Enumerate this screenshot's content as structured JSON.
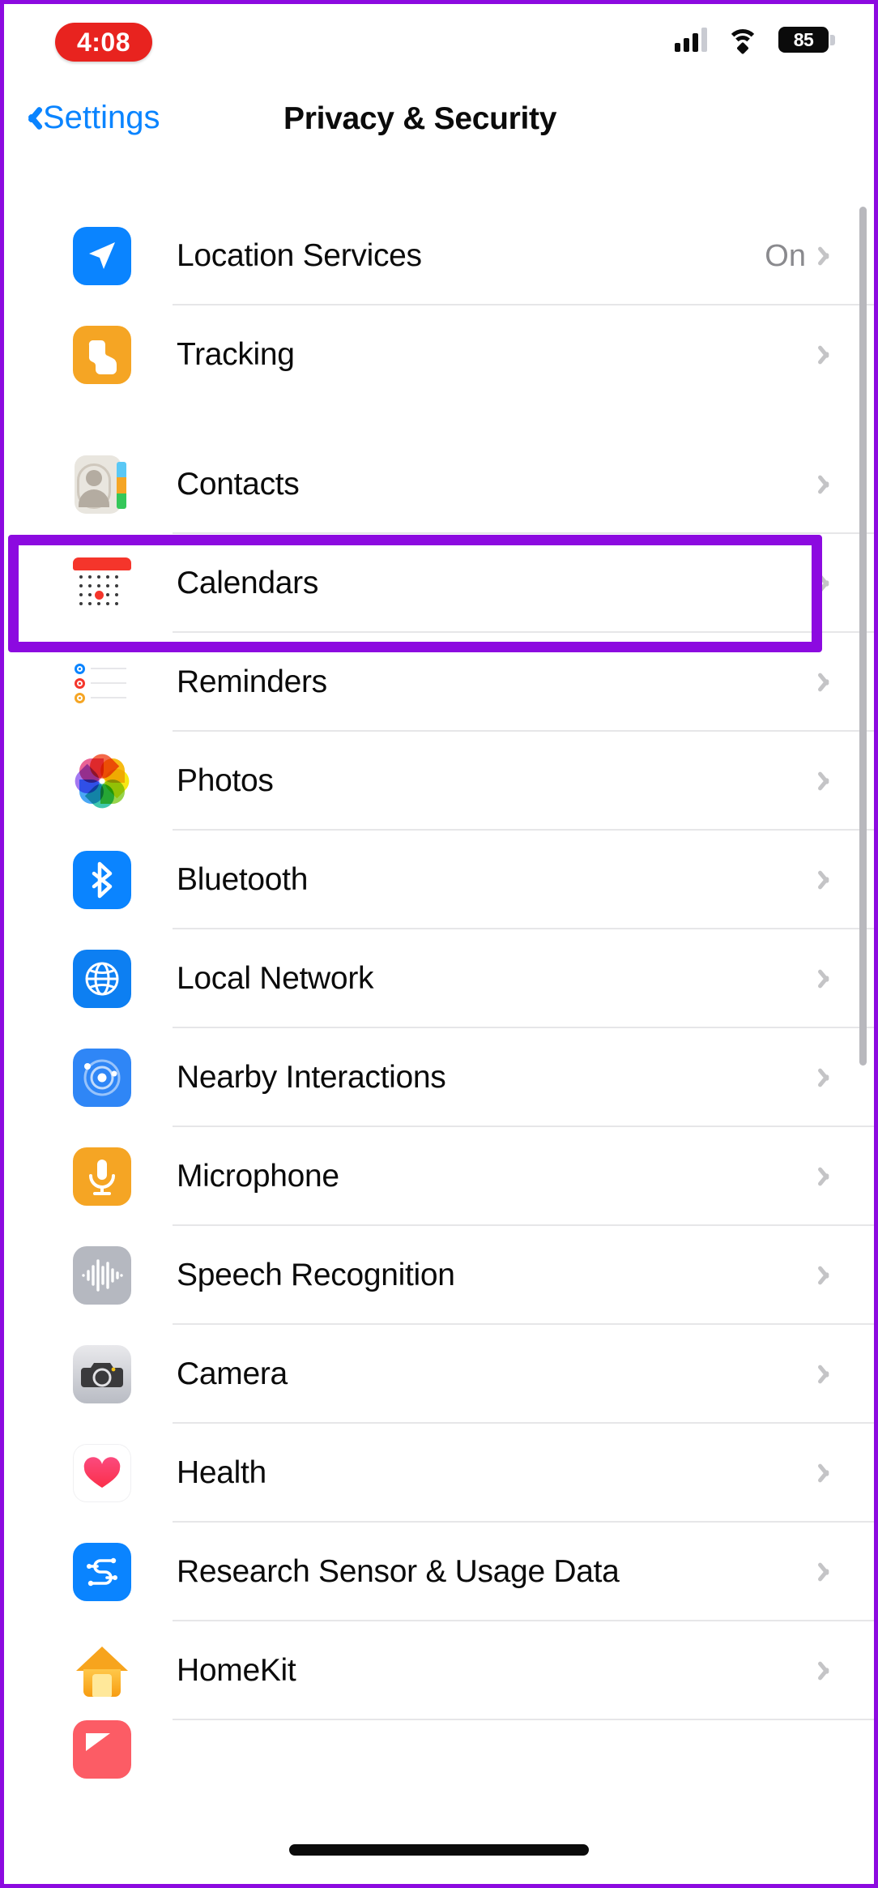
{
  "status_bar": {
    "time": "4:08",
    "time_pill_color": "#e8231f",
    "signal_icon": "cellular-signal-icon",
    "wifi_icon": "wifi-icon",
    "battery_level": "85",
    "battery_icon": "battery-icon"
  },
  "nav": {
    "back_label": "Settings",
    "back_icon": "chevron-left-icon",
    "title": "Privacy & Security",
    "accent_color": "#0a84ff"
  },
  "highlight": {
    "color": "#8c0ae0",
    "target": "Contacts"
  },
  "groups": [
    {
      "rows": [
        {
          "label": "Location Services",
          "value": "On",
          "icon": "location-arrow-icon"
        },
        {
          "label": "Tracking",
          "value": "",
          "icon": "tracking-hand-icon"
        }
      ]
    },
    {
      "rows": [
        {
          "label": "Contacts",
          "value": "",
          "icon": "contacts-card-icon"
        },
        {
          "label": "Calendars",
          "value": "",
          "icon": "calendar-icon"
        },
        {
          "label": "Reminders",
          "value": "",
          "icon": "reminders-icon"
        },
        {
          "label": "Photos",
          "value": "",
          "icon": "photos-pinwheel-icon"
        },
        {
          "label": "Bluetooth",
          "value": "",
          "icon": "bluetooth-icon"
        },
        {
          "label": "Local Network",
          "value": "",
          "icon": "globe-icon"
        },
        {
          "label": "Nearby Interactions",
          "value": "",
          "icon": "nearby-interactions-icon"
        },
        {
          "label": "Microphone",
          "value": "",
          "icon": "microphone-icon"
        },
        {
          "label": "Speech Recognition",
          "value": "",
          "icon": "speech-waveform-icon"
        },
        {
          "label": "Camera",
          "value": "",
          "icon": "camera-icon"
        },
        {
          "label": "Health",
          "value": "",
          "icon": "heart-icon"
        },
        {
          "label": "Research Sensor & Usage Data",
          "value": "",
          "icon": "research-sensor-icon"
        },
        {
          "label": "HomeKit",
          "value": "",
          "icon": "home-house-icon"
        }
      ]
    }
  ],
  "chevron_icon": "chevron-right-icon",
  "scrollbar": {
    "name": "vertical-scrollbar"
  },
  "home_indicator": {
    "name": "home-indicator"
  }
}
